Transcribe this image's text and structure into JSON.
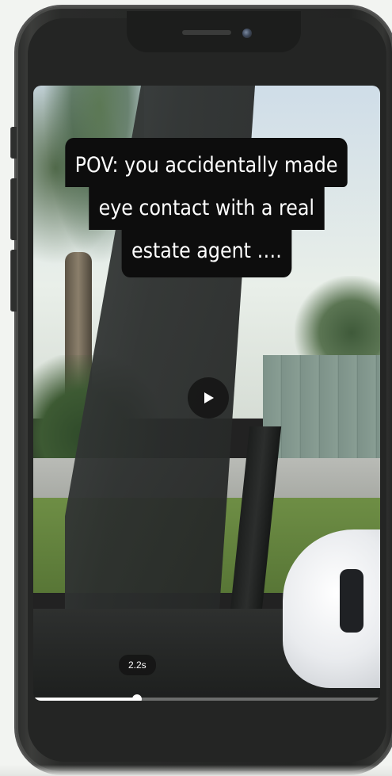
{
  "video": {
    "caption_lines": [
      "POV: you accidentally made",
      "eye contact with a real",
      "estate agent …."
    ],
    "timestamp": "2.2s",
    "progress": 0.3,
    "state": "paused"
  },
  "icons": {
    "play": "play-icon"
  }
}
